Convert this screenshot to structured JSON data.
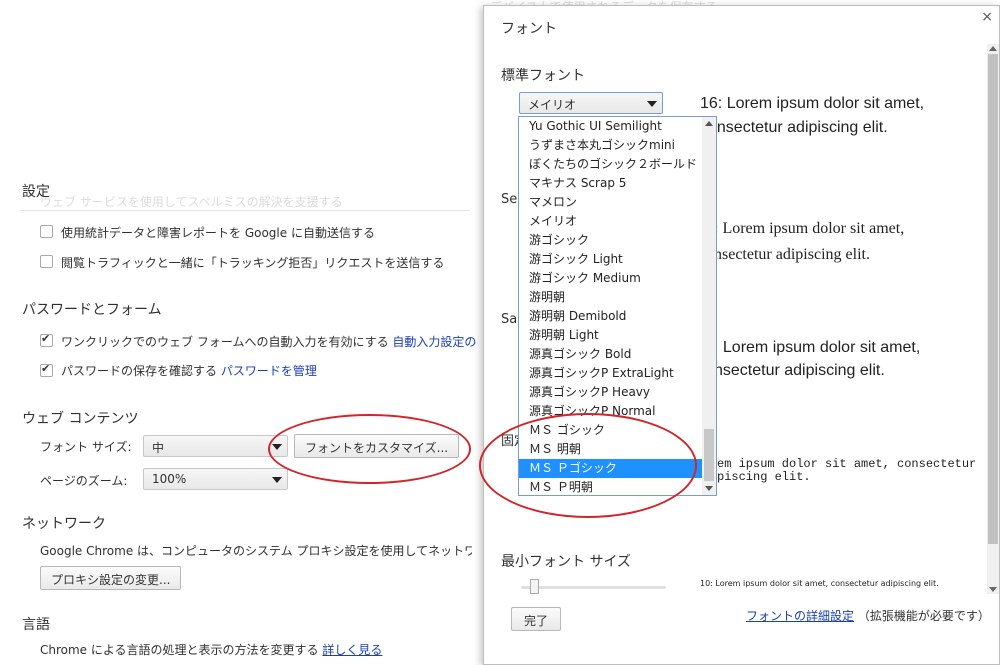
{
  "background": {
    "faint_text": [
      "デバイス上で使用されるデータを保存する",
      "ウェブ サービスを使用してスペルミスの解決を支援する"
    ],
    "privacy": {
      "title": "設定",
      "items": [
        {
          "label": "使用統計データと障害レポートを Google に自動送信する",
          "checked": false
        },
        {
          "label": "閲覧トラフィックと一緒に「トラッキング拒否」リクエストを送信する",
          "checked": false
        }
      ]
    },
    "passwords": {
      "title": "パスワードとフォーム",
      "autofill_label": "ワンクリックでのウェブ フォームへの自動入力を有効にする",
      "autofill_link": "自動入力設定の",
      "save_label": "パスワードの保存を確認する",
      "save_link": "パスワードを管理"
    },
    "web_content": {
      "title": "ウェブ コンテンツ",
      "font_size_label": "フォント サイズ:",
      "font_size_value": "中",
      "customize_button": "フォントをカスタマイズ...",
      "zoom_label": "ページのズーム:",
      "zoom_value": "100%"
    },
    "network": {
      "title": "ネットワーク",
      "description": "Google Chrome は、コンピュータのシステム プロキシ設定を使用してネットワー",
      "proxy_button": "プロキシ設定の変更..."
    },
    "language": {
      "title": "言語",
      "description": "Chrome による言語の処理と表示の方法を変更する",
      "link": "詳しく見る"
    }
  },
  "dialog": {
    "title": "フォント",
    "close_icon": "close-icon",
    "standard_font": {
      "title": "標準フォント",
      "selected": "メイリオ",
      "sample": "16: Lorem ipsum dolor sit amet, consectetur adipiscing elit."
    },
    "serif_font": {
      "title_partial": "Ser",
      "sample_line1": ": Lorem ipsum dolor sit amet,",
      "sample_line2": "nsectetur adipiscing elit."
    },
    "sans_font": {
      "title_partial": "San",
      "sample_line1": ": Lorem ipsum dolor sit amet,",
      "sample_line2": "nsectetur adipiscing elit."
    },
    "fixed_font": {
      "title_partial": "固定",
      "sample_line1": "em ipsum dolor sit amet, consectetur",
      "sample_line2": "piscing elit."
    },
    "min_font": {
      "title": "最小フォント サイズ",
      "slider_value": 0.06,
      "sample": "10: Lorem ipsum dolor sit amet, consectetur adipiscing elit."
    },
    "done_button": "完了",
    "advanced_link": "フォントの詳細設定",
    "advanced_note": "（拡張機能が必要です）"
  },
  "font_dropdown": {
    "items": [
      "Yu Gothic UI Semilight",
      "うずまさ本丸ゴシックmini",
      "ぼくたちのゴシック２ボールド",
      "マキナス Scrap 5",
      "マメロン",
      "メイリオ",
      "游ゴシック",
      "游ゴシック Light",
      "游ゴシック Medium",
      "游明朝",
      "游明朝 Demibold",
      "游明朝 Light",
      "源真ゴシック Bold",
      "源真ゴシックP ExtraLight",
      "源真ゴシックP Heavy",
      "源真ゴシックP Normal",
      "ＭＳ ゴシック",
      "ＭＳ 明朝",
      "ＭＳ Ｐゴシック",
      "ＭＳ Ｐ明朝"
    ],
    "selected_index": 18
  },
  "annotation_color": "#d0262b",
  "selection_color": "#1e90ff"
}
